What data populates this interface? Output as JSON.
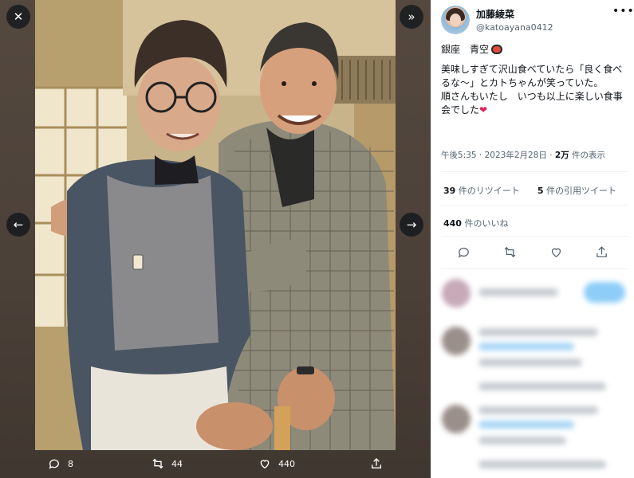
{
  "viewer": {
    "close_icon": "close-icon",
    "expand_icon": "chevron-double-right-icon",
    "prev_icon": "arrow-left-icon",
    "next_icon": "arrow-right-icon",
    "actions": {
      "replies": "8",
      "retweets": "44",
      "likes": "440"
    }
  },
  "tweet": {
    "user_name": "加藤綾菜",
    "user_handle": "@katoayana0412",
    "line1": "銀座　青空",
    "line2": "美味しすぎて沢山食べていたら「良く食べるな〜」とカトちゃんが笑っていた。",
    "line3a": "順さんもいたし　いつも以上に楽しい食事会でした",
    "time": "午後5:35 · 2023年2月28日 · ",
    "views_num": "2万",
    "views_label": " 件の表示",
    "retweets_num": "39",
    "retweets_label": " 件のリツイート",
    "quotes_num": "5",
    "quotes_label": " 件の引用ツイート",
    "likes_num": "440",
    "likes_label": " 件のいいね"
  },
  "colors": {
    "heart": "#e0245e",
    "accent": "#1d9bf0"
  }
}
